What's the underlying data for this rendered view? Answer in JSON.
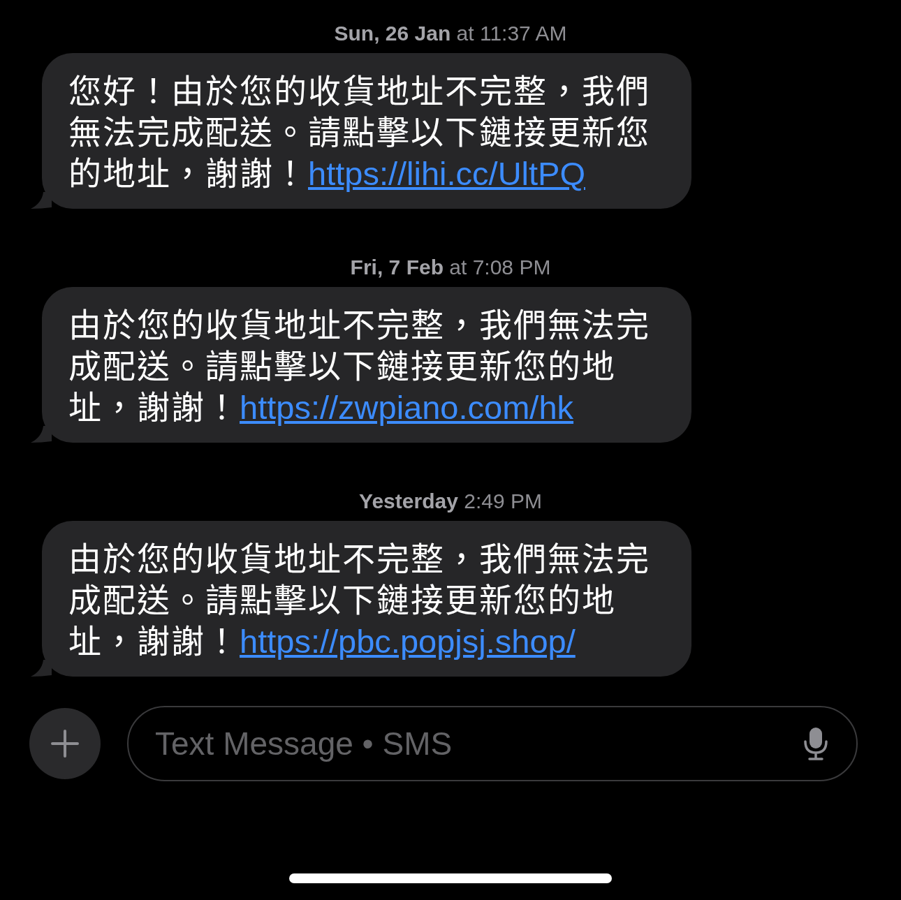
{
  "messages": [
    {
      "timestamp": "**Sun, 26 Jan** at 11:37 AM",
      "text": "您好！由於您的收貨地址不完整，我們無法完成配送。請點擊以下鏈接更新您的地址，謝謝！",
      "link": "https://lihi.cc/UltPQ"
    },
    {
      "timestamp": "**Fri, 7 Feb** at 7:08 PM",
      "text": "由於您的收貨地址不完整，我們無法完成配送。請點擊以下鏈接更新您的地址，謝謝！",
      "link": "https://zwpiano.com/hk"
    },
    {
      "timestamp": "**Yesterday** 2:49 PM",
      "text": "由於您的收貨地址不完整，我們無法完成配送。請點擊以下鏈接更新您的地址，謝謝！",
      "link": "https://pbc.popjsj.shop/"
    }
  ],
  "composer": {
    "placeholder": "Text Message • SMS"
  }
}
